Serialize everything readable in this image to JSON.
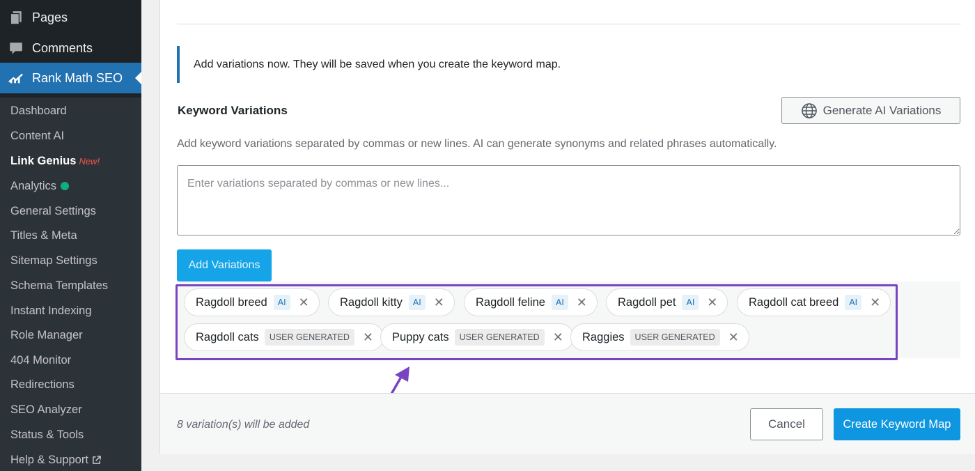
{
  "sidebar": {
    "top_items": [
      {
        "label": "Pages",
        "icon": "pages-icon"
      },
      {
        "label": "Comments",
        "icon": "comments-icon"
      },
      {
        "label": "Rank Math SEO",
        "icon": "rank-math-icon"
      }
    ],
    "submenu": [
      {
        "label": "Dashboard"
      },
      {
        "label": "Content AI"
      },
      {
        "label": "Link Genius",
        "badge": "New!"
      },
      {
        "label": "Analytics",
        "status_dot_color": "#10ac84"
      },
      {
        "label": "General Settings"
      },
      {
        "label": "Titles & Meta"
      },
      {
        "label": "Sitemap Settings"
      },
      {
        "label": "Schema Templates"
      },
      {
        "label": "Instant Indexing"
      },
      {
        "label": "Role Manager"
      },
      {
        "label": "404 Monitor"
      },
      {
        "label": "Redirections"
      },
      {
        "label": "SEO Analyzer"
      },
      {
        "label": "Status & Tools"
      },
      {
        "label": "Help & Support",
        "icon": "external-link-icon"
      }
    ]
  },
  "notice": {
    "text": "Add variations now. They will be saved when you create the keyword map."
  },
  "keyword_variations": {
    "title": "Keyword Variations",
    "generate_button": "Generate AI Variations",
    "description": "Add keyword variations separated by commas or new lines. AI can generate synonyms and related phrases automatically.",
    "input_placeholder": "Enter variations separated by commas or new lines...",
    "input_value": "",
    "add_button": "Add Variations",
    "chips": [
      {
        "label": "Ragdoll breed",
        "badge": "AI",
        "type": "ai"
      },
      {
        "label": "Ragdoll kitty",
        "badge": "AI",
        "type": "ai"
      },
      {
        "label": "Ragdoll feline",
        "badge": "AI",
        "type": "ai"
      },
      {
        "label": "Ragdoll pet",
        "badge": "AI",
        "type": "ai"
      },
      {
        "label": "Ragdoll cat breed",
        "badge": "AI",
        "type": "ai"
      },
      {
        "label": "Ragdoll cats",
        "badge": "USER GENERATED",
        "type": "user"
      },
      {
        "label": "Puppy cats",
        "badge": "USER GENERATED",
        "type": "user"
      },
      {
        "label": "Raggies",
        "badge": "USER GENERATED",
        "type": "user"
      }
    ],
    "remove_symbol": "✕"
  },
  "footer": {
    "summary": "8 variation(s) will be added",
    "cancel_button": "Cancel",
    "create_button": "Create Keyword Map"
  },
  "colors": {
    "accent": "#0f96e0",
    "highlight_annotation": "#7844c2",
    "sidebar_bg": "#1d2327",
    "active_menu": "#2271b1"
  }
}
